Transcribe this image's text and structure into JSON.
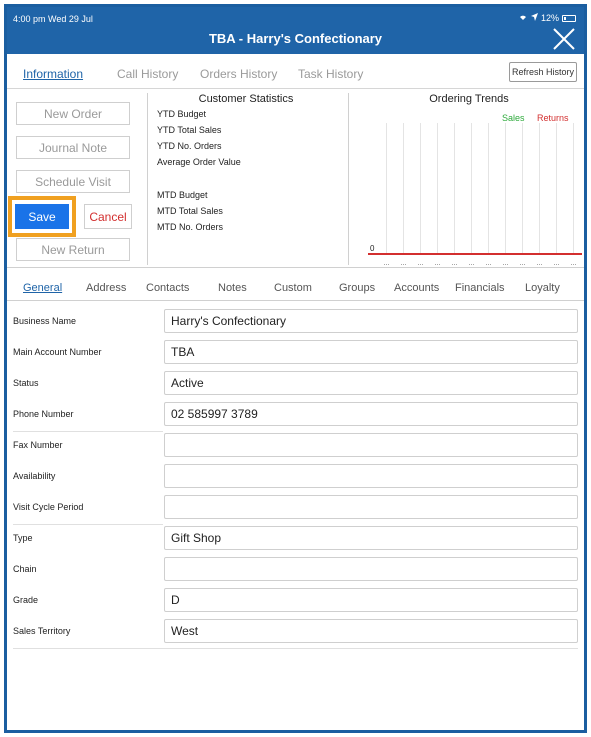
{
  "status_bar": {
    "time_date": "4:00 pm  Wed 29 Jul",
    "battery": "12%"
  },
  "header": {
    "title": "TBA - Harry's Confectionary",
    "close_icon": "close-icon"
  },
  "top_tabs": [
    "Information",
    "Call History",
    "Orders History",
    "Task History"
  ],
  "refresh_button": "Refresh History",
  "actions": {
    "new_order": "New Order",
    "journal_note": "Journal Note",
    "schedule_visit": "Schedule Visit",
    "save": "Save",
    "cancel": "Cancel",
    "new_return": "New Return"
  },
  "customer_statistics": {
    "title": "Customer Statistics",
    "labels": [
      "YTD Budget",
      "YTD Total Sales",
      "YTD No. Orders",
      "Average Order Value",
      "MTD Budget",
      "MTD Total Sales",
      "MTD No. Orders"
    ]
  },
  "ordering_trends": {
    "title": "Ordering Trends",
    "legend": [
      "Sales",
      "Returns"
    ],
    "zero_label": "0",
    "x_tick_labels": [
      "...",
      "...",
      "...",
      "...",
      "...",
      "...",
      "...",
      "...",
      "...",
      "...",
      "...",
      "..."
    ]
  },
  "sub_tabs": [
    "General",
    "Address",
    "Contacts",
    "Notes",
    "Custom",
    "Groups",
    "Accounts",
    "Financials",
    "Loyalty"
  ],
  "form": [
    {
      "label": "Business Name",
      "value": "Harry's Confectionary"
    },
    {
      "label": "Main Account Number",
      "value": "TBA"
    },
    {
      "label": "Status",
      "value": "Active"
    },
    {
      "label": "Phone Number",
      "value": "02 585997 3789"
    },
    {
      "label": "Fax Number",
      "value": ""
    },
    {
      "label": "Availability",
      "value": ""
    },
    {
      "label": "Visit Cycle Period",
      "value": ""
    },
    {
      "label": "Type",
      "value": "Gift Shop"
    },
    {
      "label": "Chain",
      "value": ""
    },
    {
      "label": "Grade",
      "value": "D"
    },
    {
      "label": "Sales Territory",
      "value": "West"
    }
  ],
  "colors": {
    "header_blue": "#1f64a8",
    "save_blue": "#1a73e8",
    "highlight_orange": "#f0a020",
    "sales_green": "#2eaa3c",
    "returns_red": "#d32f2f"
  }
}
